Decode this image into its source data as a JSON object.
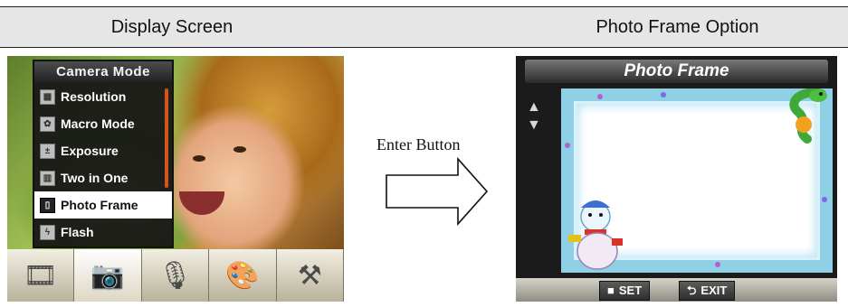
{
  "headers": {
    "left": "Display Screen",
    "right": "Photo Frame Option"
  },
  "camera_menu": {
    "title": "Camera Mode",
    "items": [
      {
        "label": "Resolution",
        "icon": "resolution-icon"
      },
      {
        "label": "Macro Mode",
        "icon": "macro-icon"
      },
      {
        "label": "Exposure",
        "icon": "exposure-icon"
      },
      {
        "label": "Two in One",
        "icon": "two-in-one-icon"
      },
      {
        "label": "Photo Frame",
        "icon": "photo-frame-icon",
        "selected": true
      },
      {
        "label": "Flash",
        "icon": "flash-icon"
      }
    ]
  },
  "mode_tabs": [
    "video-mode-icon",
    "camera-mode-icon",
    "voice-mode-icon",
    "effect-palette-icon",
    "settings-tools-icon"
  ],
  "selected_tab": "camera-mode-icon",
  "middle": {
    "label": "Enter Button"
  },
  "photo_frame": {
    "title": "Photo Frame",
    "set_label": "SET",
    "exit_label": "EXIT"
  },
  "colors": {
    "header_band": "#e6e6e6",
    "frame_blue": "#8fd0e6",
    "scroll_accent": "#d0551f"
  }
}
